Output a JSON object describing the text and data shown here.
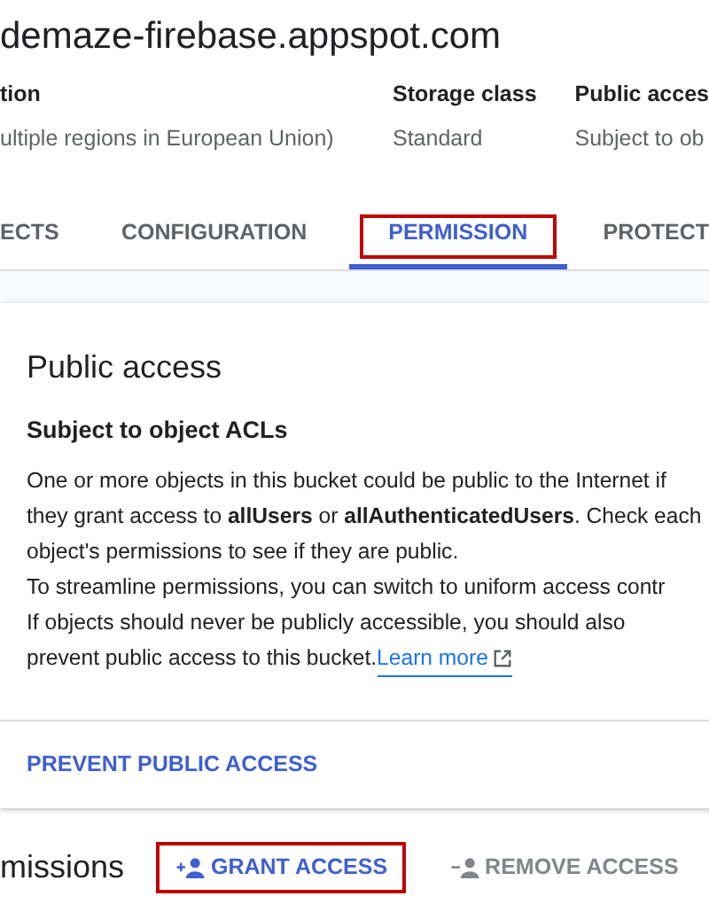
{
  "bucket_title": "demaze-firebase.appspot.com",
  "details": [
    {
      "label": "tion",
      "value": "ultiple regions in European Union)"
    },
    {
      "label": "Storage class",
      "value": "Standard"
    },
    {
      "label": "Public acces",
      "value": "Subject to ob"
    }
  ],
  "tabs": [
    {
      "label": "ECTS",
      "selected": false,
      "highlighted": false
    },
    {
      "label": "CONFIGURATION",
      "selected": false,
      "highlighted": false
    },
    {
      "label": "PERMISSION",
      "selected": true,
      "highlighted": true
    },
    {
      "label": "PROTECT",
      "selected": false,
      "highlighted": false
    }
  ],
  "public_access_card": {
    "title": "Public access",
    "subtitle": "Subject to object ACLs",
    "lines": [
      "One or more objects in this bucket could be public to the Internet if",
      "they grant access to **allUsers** or **allAuthenticatedUsers**. Check each",
      "object's permissions to see if they are public.",
      "To streamline permissions, you can switch to uniform access contr",
      "If objects should never be publicly accessible, you should also",
      "prevent public access to this bucket."
    ],
    "link": "Learn more",
    "action": "PREVENT PUBLIC ACCESS"
  },
  "permissions": {
    "title": "missions",
    "buttons": [
      {
        "label": "GRANT ACCESS",
        "kind": "grant",
        "disabled": false,
        "highlighted": true
      },
      {
        "label": "REMOVE ACCESS",
        "kind": "remove",
        "disabled": true,
        "highlighted": false
      }
    ]
  }
}
